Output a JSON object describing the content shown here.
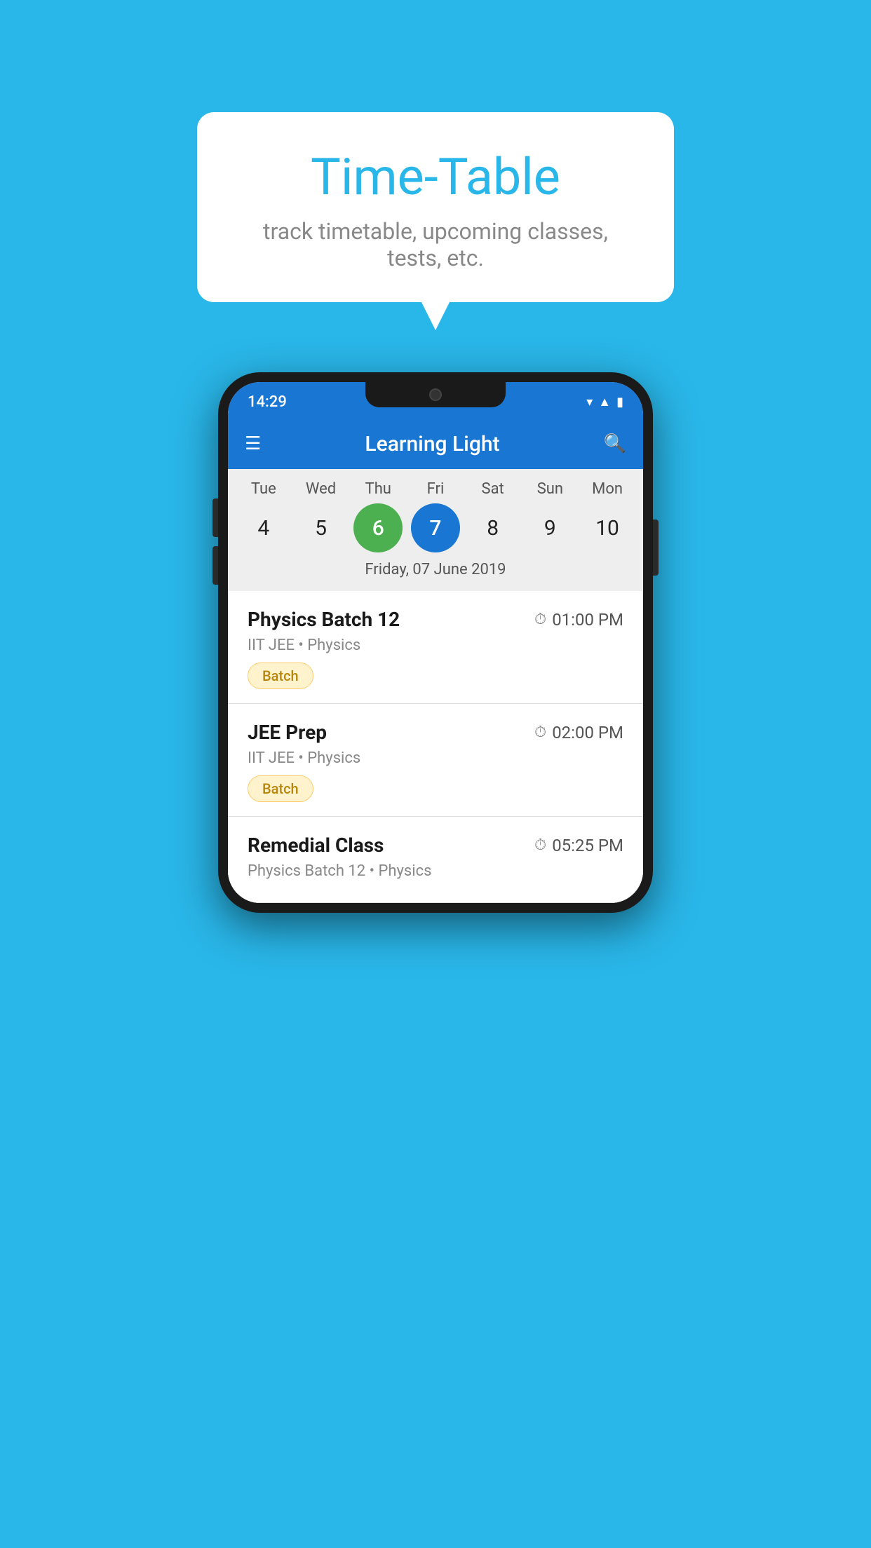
{
  "background_color": "#29B6E8",
  "bubble": {
    "title": "Time-Table",
    "subtitle": "track timetable, upcoming classes, tests, etc."
  },
  "phone": {
    "status_bar": {
      "time": "14:29"
    },
    "app_bar": {
      "title": "Learning Light"
    },
    "calendar": {
      "days": [
        {
          "label": "Tue",
          "num": "4"
        },
        {
          "label": "Wed",
          "num": "5"
        },
        {
          "label": "Thu",
          "num": "6",
          "state": "today"
        },
        {
          "label": "Fri",
          "num": "7",
          "state": "selected"
        },
        {
          "label": "Sat",
          "num": "8"
        },
        {
          "label": "Sun",
          "num": "9"
        },
        {
          "label": "Mon",
          "num": "10"
        }
      ],
      "selected_date_label": "Friday, 07 June 2019"
    },
    "schedule": [
      {
        "title": "Physics Batch 12",
        "time": "01:00 PM",
        "subtitle": "IIT JEE • Physics",
        "tag": "Batch"
      },
      {
        "title": "JEE Prep",
        "time": "02:00 PM",
        "subtitle": "IIT JEE • Physics",
        "tag": "Batch"
      },
      {
        "title": "Remedial Class",
        "time": "05:25 PM",
        "subtitle": "Physics Batch 12 • Physics",
        "tag": null
      }
    ]
  }
}
